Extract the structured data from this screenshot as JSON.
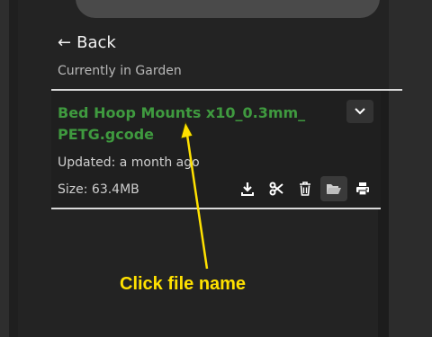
{
  "nav": {
    "back_label": "Back",
    "back_arrow": "←",
    "location_text": "Currently in Garden"
  },
  "file": {
    "name_line1": "Bed Hoop Mounts x10_0.3mm_",
    "name_line2": "PETG.gcode",
    "updated": "Updated: a month ago",
    "size": "Size: 63.4MB"
  },
  "actions": [
    {
      "icon": "download-icon"
    },
    {
      "icon": "scissors-icon"
    },
    {
      "icon": "trash-icon"
    },
    {
      "icon": "folder-open-icon"
    },
    {
      "icon": "printer-icon"
    }
  ],
  "annotation": {
    "text": "Click file name",
    "color": "#ffe100"
  },
  "colors": {
    "file_name": "#3f9a3f",
    "background": "#262626"
  }
}
